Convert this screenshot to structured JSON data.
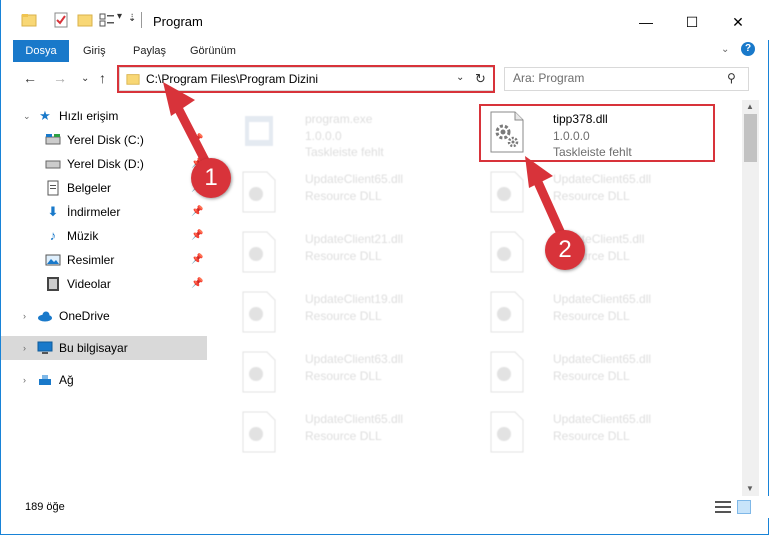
{
  "titlebar": {
    "title": "Program",
    "min_glyph": "—",
    "max_glyph": "☐",
    "close_glyph": "✕"
  },
  "ribbon": {
    "tabs": [
      {
        "label": "Dosya",
        "active": true
      },
      {
        "label": "Giriş"
      },
      {
        "label": "Paylaş"
      },
      {
        "label": "Görünüm"
      }
    ],
    "help_glyph": "?"
  },
  "address": {
    "path": "C:\\Program Files\\Program Dizini"
  },
  "search": {
    "placeholder": "Ara: Program"
  },
  "sidebar": {
    "items": [
      {
        "label": "Hızlı erişim",
        "icon": "star-icon"
      },
      {
        "label": "Yerel Disk (C:)",
        "icon": "drive-icon"
      },
      {
        "label": "Yerel Disk (D:)",
        "icon": "drive-icon"
      },
      {
        "label": "Belgeler",
        "icon": "documents-icon"
      },
      {
        "label": "İndirmeler",
        "icon": "downloads-icon"
      },
      {
        "label": "Müzik",
        "icon": "music-icon"
      },
      {
        "label": "Resimler",
        "icon": "pictures-icon"
      },
      {
        "label": "Videolar",
        "icon": "videos-icon"
      },
      {
        "label": "OneDrive",
        "icon": "cloud-icon"
      },
      {
        "label": "Bu bilgisayar",
        "icon": "computer-icon"
      },
      {
        "label": "Ağ",
        "icon": "network-icon"
      }
    ]
  },
  "files": [
    {
      "name": "program.exe",
      "line1": "1.0.0.0",
      "line2": "Taskleiste fehlt"
    },
    {
      "name": "tipp378.dll",
      "line1": "1.0.0.0",
      "line2": "Taskleiste fehlt"
    },
    {
      "name": "UpdateClient65.dll",
      "line1": "Resource DLL"
    },
    {
      "name": "UpdateClient65.dll",
      "line1": "Resource DLL"
    },
    {
      "name": "UpdateClient21.dll",
      "line1": "Resource DLL"
    },
    {
      "name": "UpdateClient5.dll",
      "line1": "Resource DLL"
    },
    {
      "name": "UpdateClient19.dll",
      "line1": "Resource DLL"
    },
    {
      "name": "UpdateClient65.dll",
      "line1": "Resource DLL"
    },
    {
      "name": "UpdateClient63.dll",
      "line1": "Resource DLL"
    },
    {
      "name": "UpdateClient65.dll",
      "line1": "Resource DLL"
    },
    {
      "name": "UpdateClient65.dll",
      "line1": "Resource DLL"
    },
    {
      "name": "UpdateClient65.dll",
      "line1": "Resource DLL"
    }
  ],
  "status": {
    "item_count": "189 öğe"
  },
  "callouts": {
    "step1": "1",
    "step2": "2"
  },
  "colors": {
    "accent": "#1979ca",
    "callout_red": "#d8333a",
    "selected_bg": "#d9d9d9"
  }
}
